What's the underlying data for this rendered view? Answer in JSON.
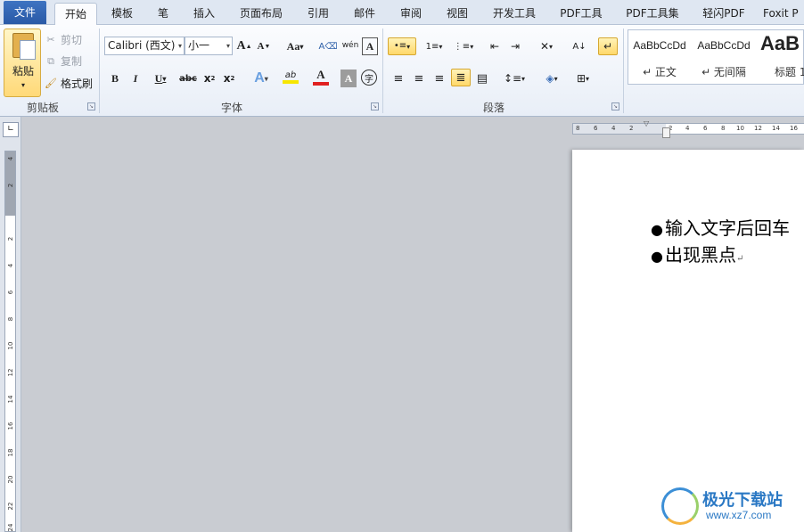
{
  "tabs": [
    "文件",
    "开始",
    "模板",
    "笔",
    "插入",
    "页面布局",
    "引用",
    "邮件",
    "审阅",
    "视图",
    "开发工具",
    "PDF工具",
    "PDF工具集",
    "轻闪PDF",
    "Foxit P"
  ],
  "clipboard": {
    "paste": "粘贴",
    "cut": "剪切",
    "copy": "复制",
    "format_painter": "格式刷",
    "group_label": "剪贴板"
  },
  "font": {
    "font_name": "Calibri (西文)",
    "font_size": "小一",
    "grow": "A",
    "shrink": "A",
    "change_case": "Aa",
    "bold": "B",
    "italic": "I",
    "underline": "U",
    "strikethrough": "abc",
    "subscript": "x",
    "superscript": "x",
    "text_effect": "A",
    "highlight": "ab",
    "font_color": "A",
    "char_shading": "A",
    "enclose": "字",
    "phonetic": "wén",
    "group_label": "字体"
  },
  "paragraph": {
    "group_label": "段落"
  },
  "styles": [
    {
      "sample": "AaBbCcDd",
      "name": "↵ 正文"
    },
    {
      "sample": "AaBbCcDd",
      "name": "↵ 无间隔"
    },
    {
      "sample": "AaB",
      "name": "标题 1"
    }
  ],
  "ruler": {
    "h_ticks": [
      "8",
      "6",
      "4",
      "2",
      "2",
      "4",
      "6",
      "8",
      "10",
      "12",
      "14",
      "16"
    ],
    "v_ticks": [
      "4",
      "2",
      "2",
      "4",
      "6",
      "8",
      "10",
      "12",
      "14",
      "16",
      "18",
      "20",
      "22",
      "24"
    ]
  },
  "document": {
    "lines": [
      "输入文字后回车",
      "出现黑点"
    ],
    "bullet": "●",
    "para_mark": "↵"
  },
  "watermark": {
    "title": "极光下载站",
    "url": "www.xz7.com"
  },
  "colors": {
    "file_tab": "#2a5aa6",
    "font_color_bar": "#e02020",
    "highlight_bar": "#f7e600"
  }
}
